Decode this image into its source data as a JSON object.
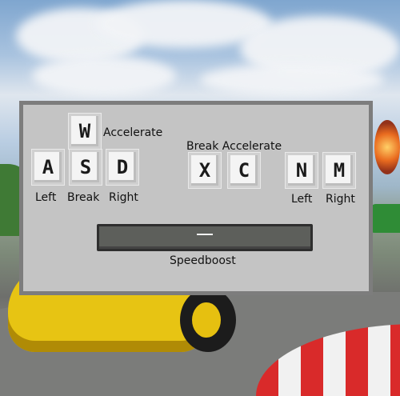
{
  "player1": {
    "accelerate_label": "Accelerate",
    "keys": {
      "up": "W",
      "left": "A",
      "down": "S",
      "right": "D"
    },
    "left_label": "Left",
    "break_label": "Break",
    "right_label": "Right"
  },
  "player2": {
    "header_label": "Break Accelerate",
    "keys": {
      "break": "X",
      "accelerate": "C",
      "left": "N",
      "right": "M"
    },
    "left_label": "Left",
    "right_label": "Right"
  },
  "speedboost": {
    "label": "Speedboost"
  }
}
